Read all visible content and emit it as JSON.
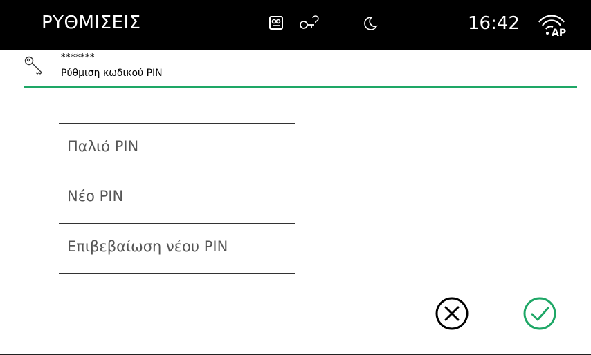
{
  "statusbar": {
    "title": "ΡΥΘΜΙΣΕΙΣ",
    "time": "16:42",
    "icons": [
      "intercom-icon",
      "key-lock-icon",
      "moon-icon",
      "wifi-ap-icon"
    ],
    "wifi_label": "AP"
  },
  "header": {
    "icon": "key-icon",
    "masked_pin": "*******",
    "subtitle": "Ρύθμιση κωδικού PIN",
    "accent_color": "#1ea766"
  },
  "form": {
    "fields": [
      {
        "label": "Παλιό PIN"
      },
      {
        "label": "Νέο PIN"
      },
      {
        "label": "Επιβεβαίωση νέου PIN"
      }
    ]
  },
  "actions": {
    "cancel": {
      "icon": "cancel-circle-icon",
      "color": "#000000"
    },
    "confirm": {
      "icon": "confirm-check-circle-icon",
      "color": "#1ea766"
    }
  }
}
